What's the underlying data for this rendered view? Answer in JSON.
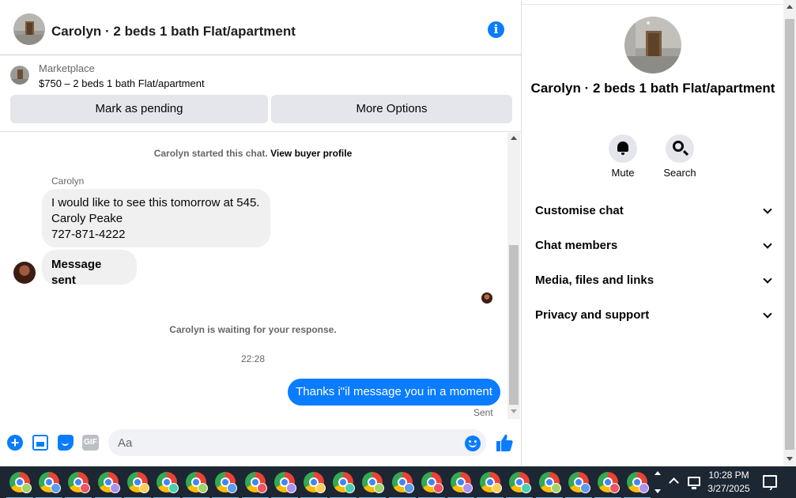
{
  "chat_header": {
    "title": "Carolyn · 2 beds 1 bath Flat/apartment",
    "info_icon": "info-icon"
  },
  "marketplace": {
    "label": "Marketplace",
    "listing": "$750 – 2 beds 1 bath Flat/apartment",
    "mark_pending_label": "Mark as pending",
    "more_options_label": "More Options"
  },
  "messages": {
    "system_start": "Carolyn started this chat.",
    "view_buyer_profile": "View buyer profile",
    "sender_name": "Carolyn",
    "incoming_1_line_1": "I would like to see this tomorrow at 545.",
    "incoming_1_line_2": "Caroly Peake",
    "incoming_1_line_3": "727-871-4222",
    "incoming_2": "Message sent",
    "system_waiting": "Carolyn is waiting for your response.",
    "timestamp": "22:28",
    "outgoing_1": "Thanks i\"il message you in a moment",
    "outgoing_status": "Sent"
  },
  "composer": {
    "placeholder": "Aa",
    "gif_label": "GIF",
    "icons": [
      "plus-icon",
      "photo-icon",
      "sticker-icon",
      "gif-icon",
      "emoji-icon",
      "like-icon"
    ]
  },
  "info_panel": {
    "title": "Carolyn · 2 beds 1 bath Flat/apartment",
    "actions": [
      {
        "label": "Mute",
        "icon": "bell-icon"
      },
      {
        "label": "Search",
        "icon": "search-icon"
      }
    ],
    "sections": [
      {
        "label": "Customise chat"
      },
      {
        "label": "Chat members"
      },
      {
        "label": "Media, files and links"
      },
      {
        "label": "Privacy and support"
      }
    ]
  },
  "taskbar": {
    "app_icon": "chrome-icon",
    "app_count": 22,
    "time": "10:28 PM",
    "date": "3/27/2025"
  },
  "colors": {
    "messenger_blue": "#0a7cff",
    "bubble_gray": "#f0f0f0",
    "button_gray": "#e4e6eb",
    "taskbar": "#1d2633"
  }
}
